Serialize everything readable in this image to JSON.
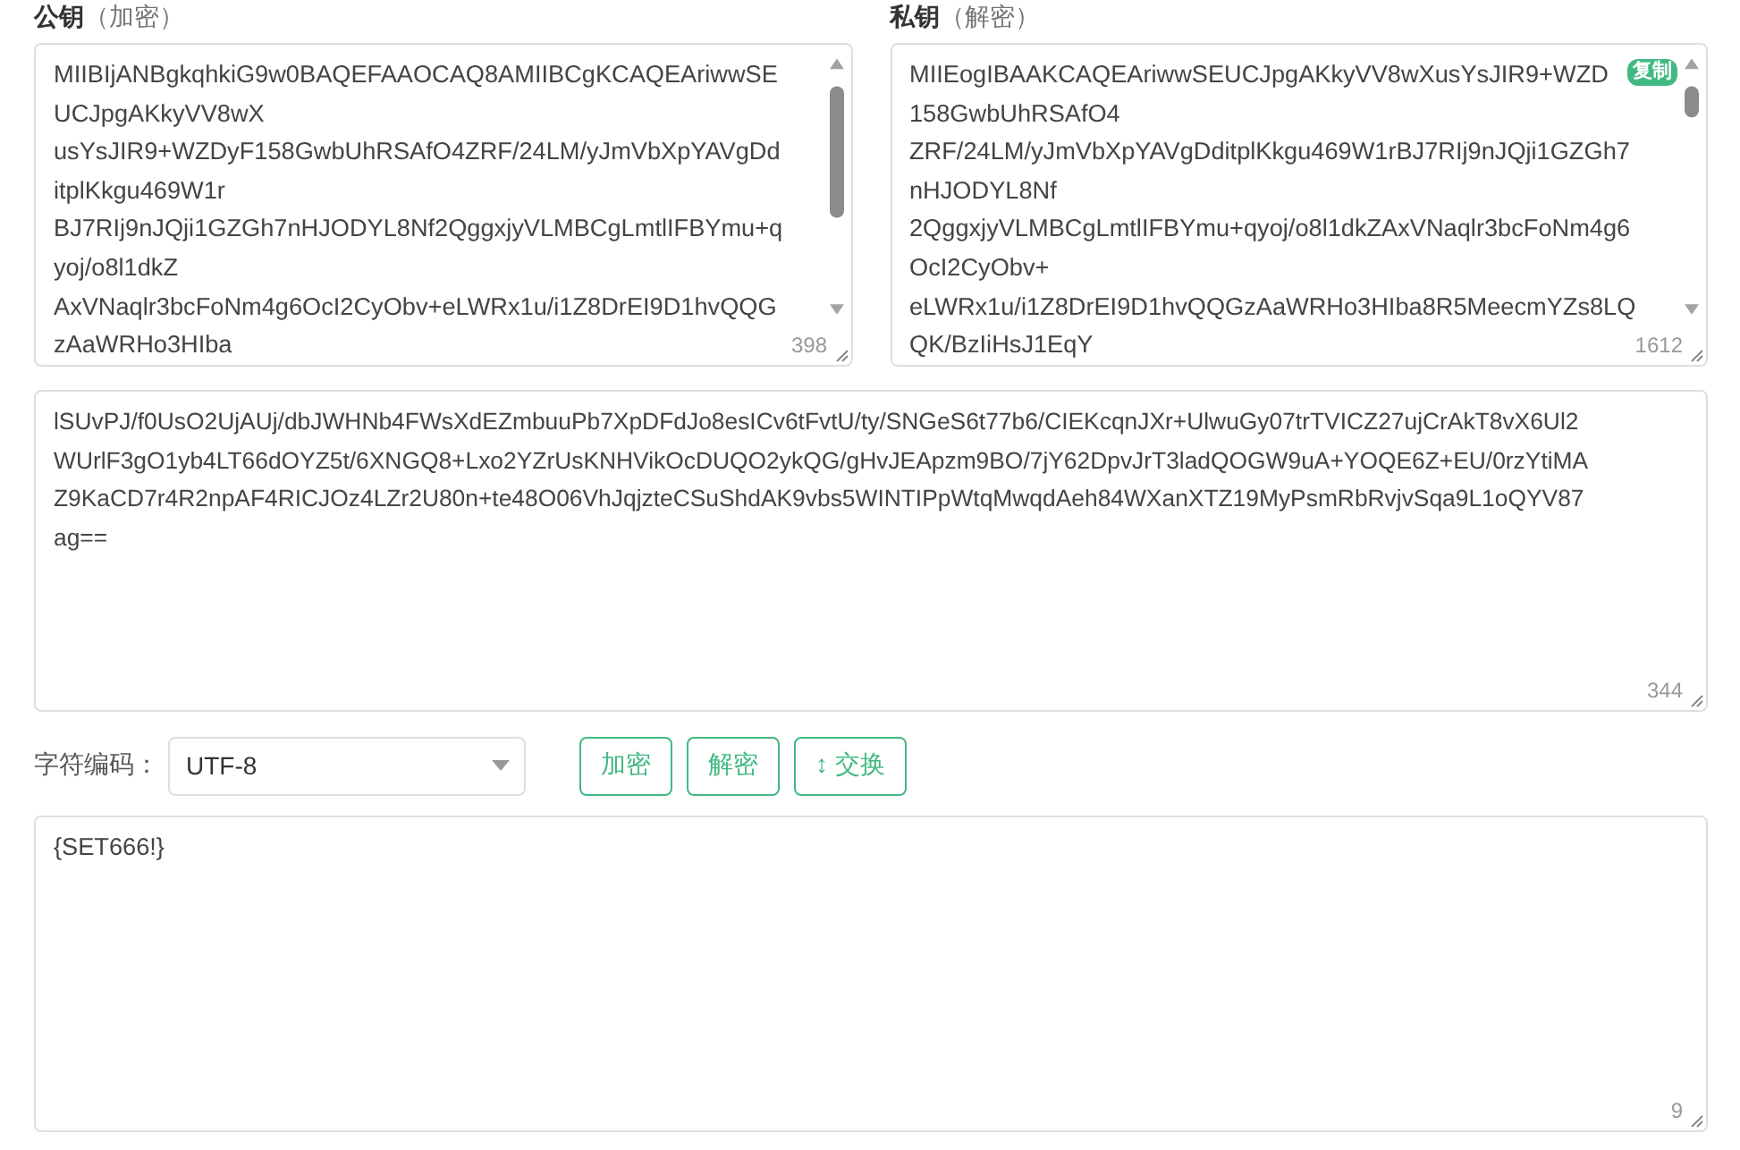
{
  "keys": [
    {
      "title": "公钥",
      "hint": "（加密）",
      "lines": [
        "MIIBIjANBgkqhkiG9w0BAQEFAAOCAQ8AMIIBCgKCAQEAriwwSE",
        "UCJpgAKkyVV8wX",
        "usYsJIR9+WZDyF158GwbUhRSAfO4ZRF/24LM/yJmVbXpYAVgDd",
        "itplKkgu469W1r",
        "BJ7RIj9nJQji1GZGh7nHJODYL8Nf2QggxjyVLMBCgLmtlIFBYmu+q",
        "yoj/o8l1dkZ",
        "AxVNaqlr3bcFoNm4g6OcI2CyObv+eLWRx1u/i1Z8DrEI9D1hvQQG",
        "zAaWRHo3HIba"
      ],
      "count": "398"
    },
    {
      "title": "私钥",
      "hint": "（解密）",
      "lines": [
        "MIIEogIBAAKCAQEAriwwSEUCJpgAKkyVV8wXusYsJIR9+WZD",
        "158GwbUhRSAfO4",
        "ZRF/24LM/yJmVbXpYAVgDditplKkgu469W1rBJ7RIj9nJQji1GZGh7",
        "nHJODYL8Nf",
        "2QggxjyVLMBCgLmtlIFBYmu+qyoj/o8l1dkZAxVNaqlr3bcFoNm4g6",
        "OcI2CyObv+",
        "eLWRx1u/i1Z8DrEI9D1hvQQGzAaWRHo3HIba8R5MeecmYZs8LQ",
        "QK/BzIiHsJ1EqY"
      ],
      "count": "1612",
      "copy_badge": "复制"
    }
  ],
  "cipher": {
    "lines": [
      "lSUvPJ/f0UsO2UjAUj/dbJWHNb4FWsXdEZmbuuPb7XpDFdJo8esICv6tFvtU/ty/SNGeS6t77b6/CIEKcqnJXr+UlwuGy07trTVICZ27ujCrAkT8vX6Ul2",
      "WUrlF3gO1yb4LT66dOYZ5t/6XNGQ8+Lxo2YZrUsKNHVikOcDUQO2ykQG/gHvJEApzm9BO/7jY62DpvJrT3ladQOGW9uA+YOQE6Z+EU/0rzYtiMA",
      "Z9KaCD7r4R2npAF4RICJOz4LZr2U80n+te48O06VhJqjzteCSuShdAK9vbs5WINTIPpWtqMwqdAeh84WXanXTZ19MyPsmRbRvjvSqa9L1oQYV87",
      "ag=="
    ],
    "count": "344"
  },
  "encoding": {
    "label": "字符编码：",
    "value": "UTF-8"
  },
  "buttons": [
    {
      "label": "加密"
    },
    {
      "label": "解密"
    },
    {
      "label": "交换",
      "icon": "↕"
    }
  ],
  "plain": {
    "value": "{SET666!}",
    "count": "9"
  }
}
